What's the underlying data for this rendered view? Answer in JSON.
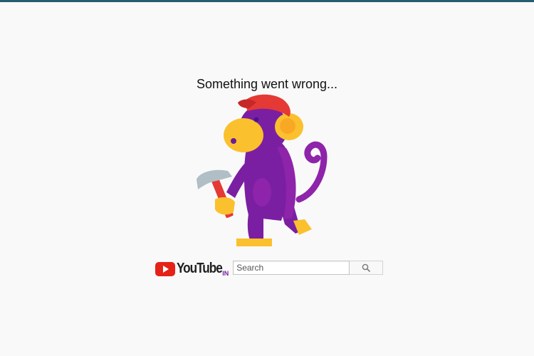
{
  "error": {
    "message": "Something went wrong..."
  },
  "branding": {
    "logo_text": "YouTube",
    "country_code": "IN",
    "logo_red": "#e62117",
    "country_color": "#7a1fa2"
  },
  "search": {
    "placeholder": "Search",
    "value": "",
    "button_icon": "search-icon"
  },
  "illustration": {
    "subject": "monkey-with-hammer",
    "colors": {
      "body": "#7b1fa2",
      "face": "#fbc02d",
      "cap": "#e53935",
      "hammer_handle": "#e53935",
      "hammer_head": "#b0bec5"
    }
  }
}
